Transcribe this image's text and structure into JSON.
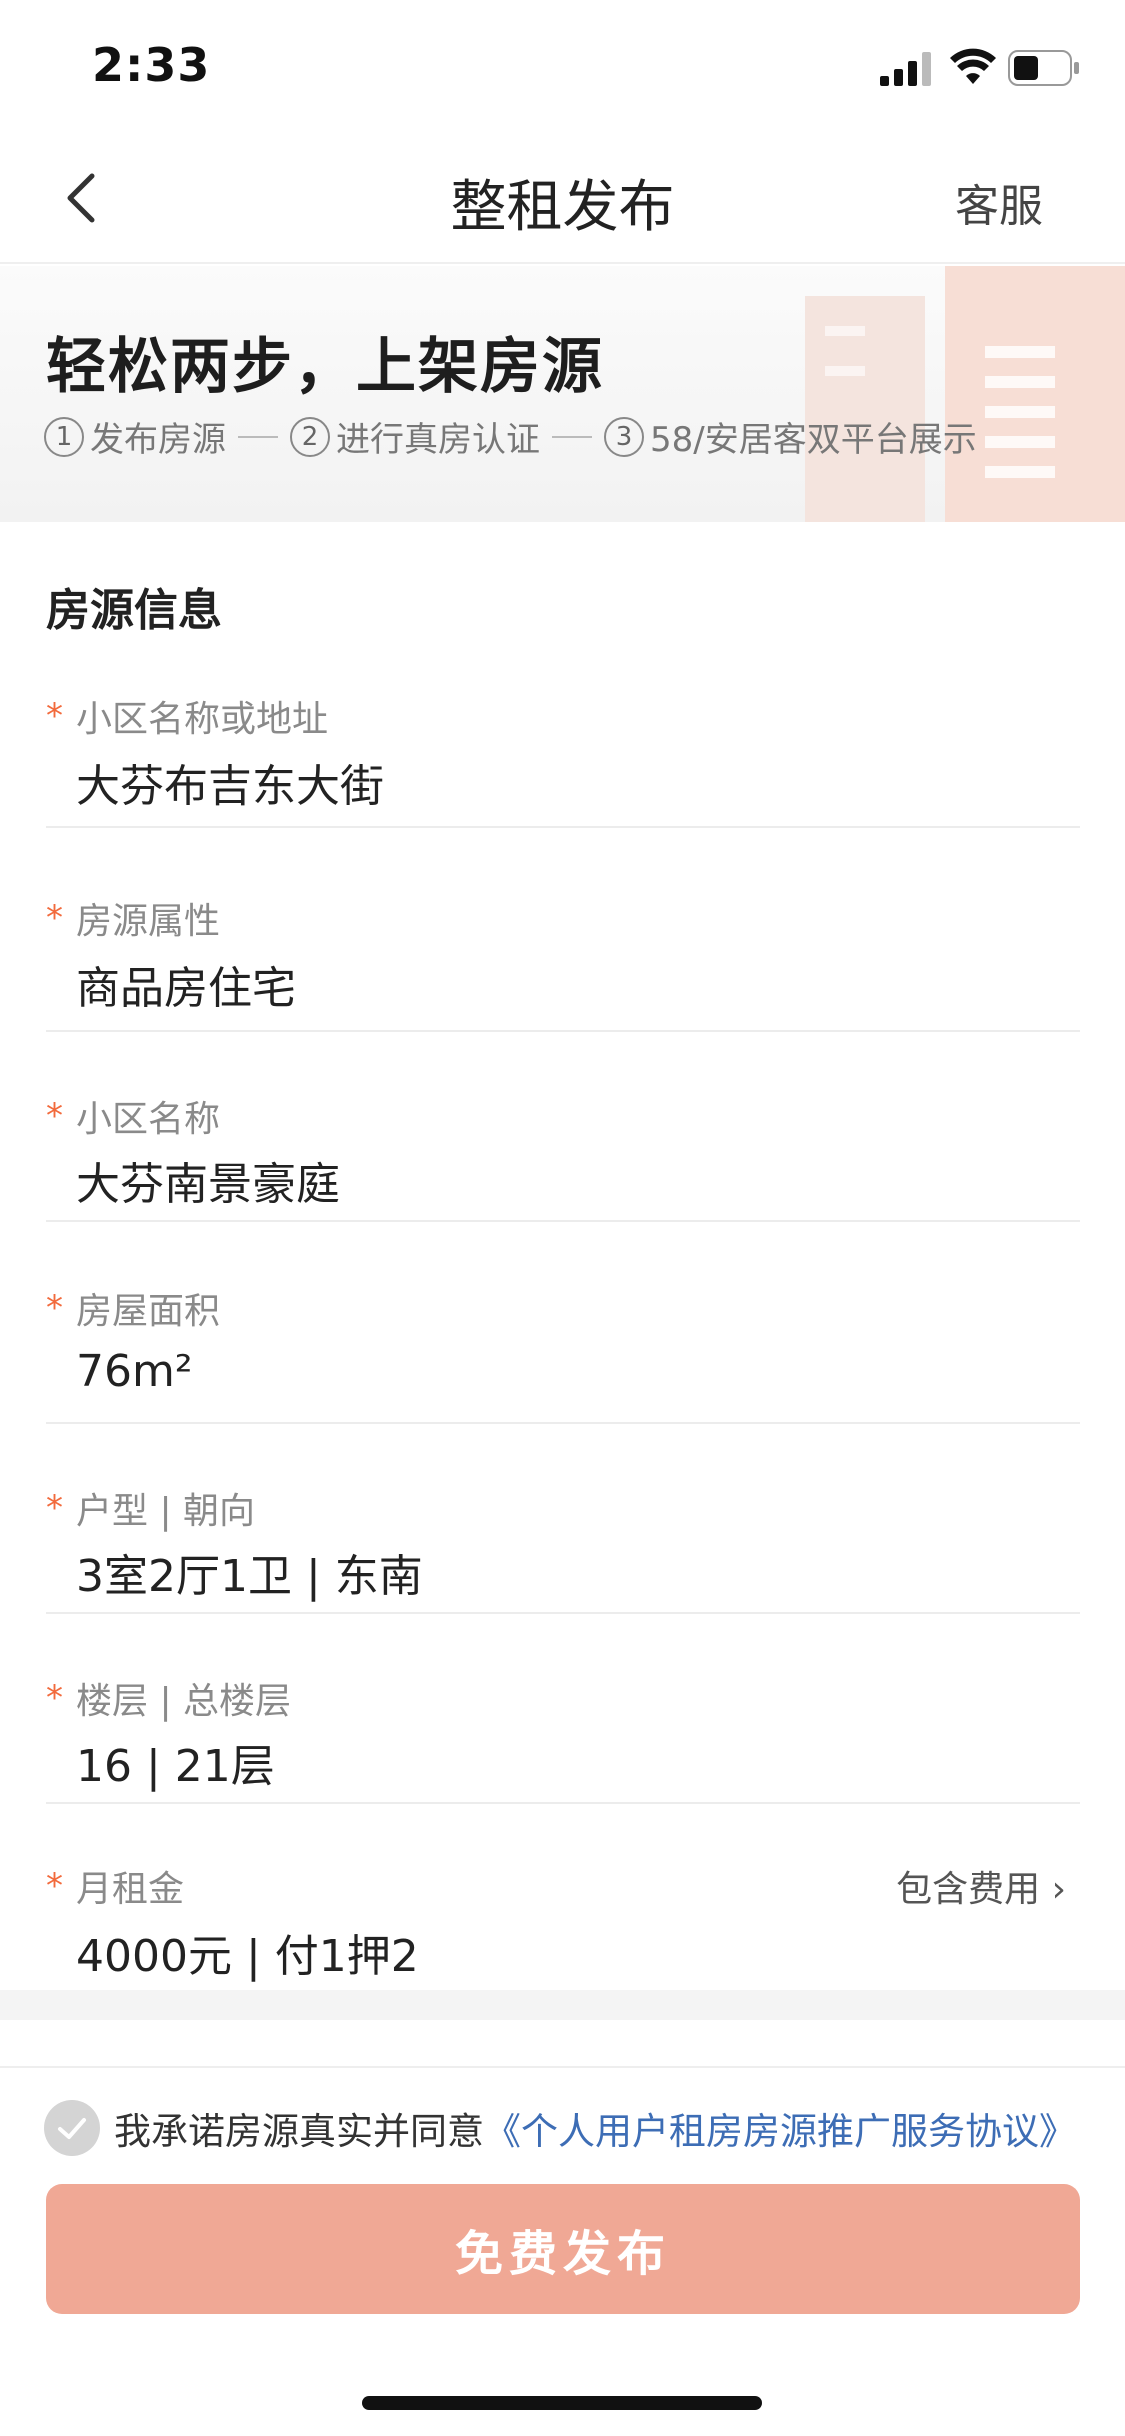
{
  "status_bar": {
    "time": "2:33"
  },
  "nav": {
    "title": "整租发布",
    "service_label": "客服"
  },
  "banner": {
    "title": "轻松两步，上架房源",
    "steps": [
      {
        "num": "1",
        "label": "发布房源"
      },
      {
        "num": "2",
        "label": "进行真房认证"
      },
      {
        "num": "3",
        "label": "58/安居客双平台展示"
      }
    ]
  },
  "section": {
    "title": "房源信息"
  },
  "fields": [
    {
      "label": "小区名称或地址",
      "value": "大芬布吉东大街",
      "required": "*"
    },
    {
      "label": "房源属性",
      "value": "商品房住宅",
      "required": "*"
    },
    {
      "label": "小区名称",
      "value": "大芬南景豪庭",
      "required": "*"
    },
    {
      "label": "房屋面积",
      "value": "76m²",
      "required": "*"
    },
    {
      "label": "户型 | 朝向",
      "value": "3室2厅1卫 | 东南",
      "required": "*"
    },
    {
      "label": "楼层 | 总楼层",
      "value": "16 | 21层",
      "required": "*"
    },
    {
      "label": "月租金",
      "value": "4000元 | 付1押2",
      "required": "*",
      "extra": "包含费用 ›"
    }
  ],
  "agreement": {
    "text": "我承诺房源真实并同意",
    "link": "《个人用户租房房源推广服务协议》"
  },
  "submit": {
    "label": "免费发布"
  },
  "colors": {
    "accent": "#f26a3c",
    "button": "#f0a895",
    "link": "#3d6db5"
  }
}
